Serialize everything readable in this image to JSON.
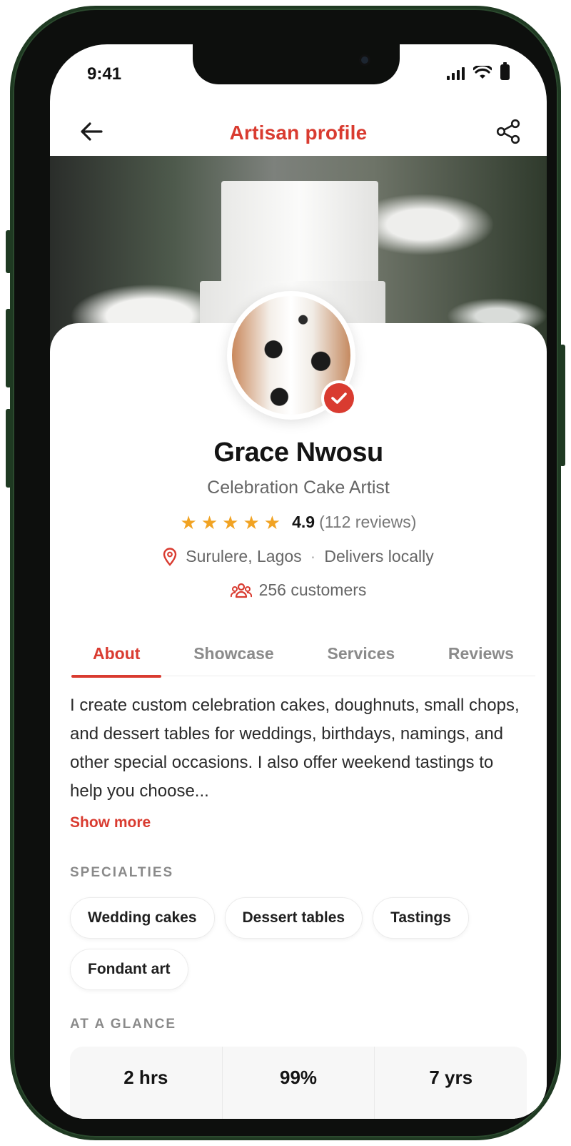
{
  "status_bar": {
    "time": "9:41"
  },
  "header": {
    "title": "Artisan profile"
  },
  "profile": {
    "name": "Grace Nwosu",
    "role": "Celebration Cake Artist",
    "rating": "4.9",
    "rating_stars": 5,
    "reviews_text": "(112 reviews)",
    "location": "Surulere, Lagos",
    "delivery": "Delivers locally",
    "customers": "256 customers"
  },
  "tabs": [
    {
      "label": "About",
      "active": true
    },
    {
      "label": "Showcase",
      "active": false
    },
    {
      "label": "Services",
      "active": false
    },
    {
      "label": "Reviews",
      "active": false
    }
  ],
  "about": {
    "text": "I create custom celebration cakes, doughnuts, small chops, and dessert tables for weddings, birthdays, namings, and other special occasions. I also offer weekend tastings to help you choose...",
    "show_more": "Show more"
  },
  "specialties": {
    "label": "SPECIALTIES",
    "items": [
      "Wedding cakes",
      "Dessert tables",
      "Tastings",
      "Fondant art"
    ]
  },
  "glance": {
    "label": "AT A GLANCE",
    "stats": [
      "2 hrs",
      "99%",
      "7 yrs"
    ]
  },
  "colors": {
    "accent": "#d93b30",
    "star": "#f1a323",
    "phone_frame": "#1f3a22"
  },
  "icons": {
    "back": "arrow-left-icon",
    "share": "share-icon",
    "verified": "verified-check-icon",
    "location": "map-pin-icon",
    "customers": "users-icon",
    "star": "star-icon"
  }
}
